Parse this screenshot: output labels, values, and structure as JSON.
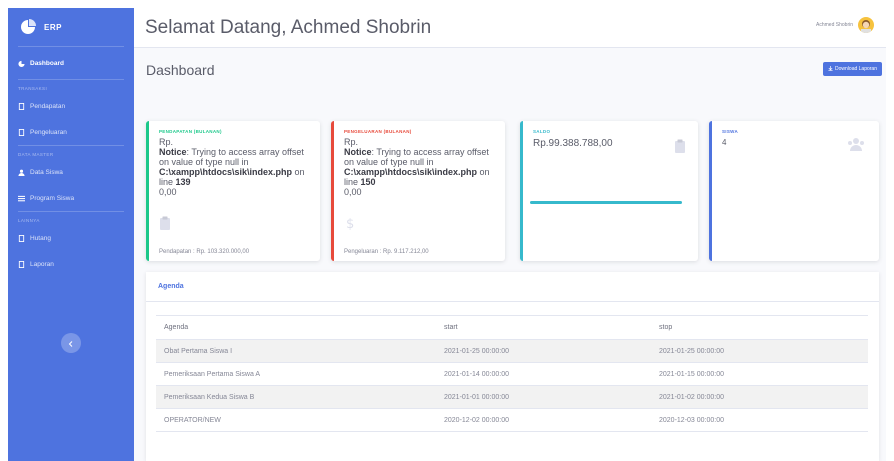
{
  "app": {
    "brand": "ERP"
  },
  "sidebar": {
    "items": [
      {
        "label": "Dashboard",
        "icon": "dashboard-icon"
      },
      {
        "heading": "Transaksi"
      },
      {
        "label": "Pendapatan",
        "icon": "file-icon"
      },
      {
        "label": "Pengeluaran",
        "icon": "file-icon"
      },
      {
        "heading": "Data Master"
      },
      {
        "label": "Data Siswa",
        "icon": "users-icon"
      },
      {
        "label": "Program Siswa",
        "icon": "list-icon"
      },
      {
        "heading": "Lainnya"
      },
      {
        "label": "Hutang",
        "icon": "file-icon"
      },
      {
        "label": "Laporan",
        "icon": "file-icon"
      }
    ]
  },
  "topbar": {
    "welcome": "Selamat Datang, Achmed Shobrin",
    "user_name": "Achmed Shobrin"
  },
  "page": {
    "title": "Dashboard",
    "report_button": "Download Laporan"
  },
  "cards": {
    "income": {
      "title": "PENDAPATAN (BULANAN)",
      "currency": "Rp.",
      "notice_label": "Notice",
      "notice_text": ": Trying to access array offset on value of type null in",
      "notice_path": "C:\\xampp\\htdocs\\sik\\index.php",
      "notice_line_prefix": " on line ",
      "notice_line": "139",
      "value": "0,00",
      "footer": "Pendapatan : Rp. 103.320.000,00",
      "color": "#1cc88a"
    },
    "expense": {
      "title": "PENGELUARAN (BULANAN)",
      "currency": "Rp.",
      "notice_label": "Notice",
      "notice_text": ": Trying to access array offset on value of type null in",
      "notice_path": "C:\\xampp\\htdocs\\sik\\index.php",
      "notice_line_prefix": " on line ",
      "notice_line": "150",
      "value": "0,00",
      "footer": "Pengeluaran : Rp. 9.117.212,00",
      "color": "#e74a3b"
    },
    "balance": {
      "title": "SALDO",
      "value": "Rp.99.388.788,00",
      "progress": 1.0,
      "color": "#36b9cc"
    },
    "students": {
      "title": "SISWA",
      "value": "4",
      "color": "#4e73df"
    }
  },
  "agenda": {
    "title": "Agenda",
    "columns": [
      "Agenda",
      "start",
      "stop"
    ],
    "rows": [
      [
        "Obat Pertama Siswa I",
        "2021-01-25 00:00:00",
        "2021-01-25 00:00:00"
      ],
      [
        "Pemeriksaan Pertama Siswa A",
        "2021-01-14 00:00:00",
        "2021-01-15 00:00:00"
      ],
      [
        "Pemeriksaan Kedua Siswa B",
        "2021-01-01 00:00:00",
        "2021-01-02 00:00:00"
      ],
      [
        "OPERATOR/NEW",
        "2020-12-02 00:00:00",
        "2020-12-03 00:00:00"
      ]
    ]
  },
  "colors": {
    "primary": "#4e73df",
    "success": "#1cc88a",
    "danger": "#e74a3b",
    "info": "#36b9cc"
  }
}
